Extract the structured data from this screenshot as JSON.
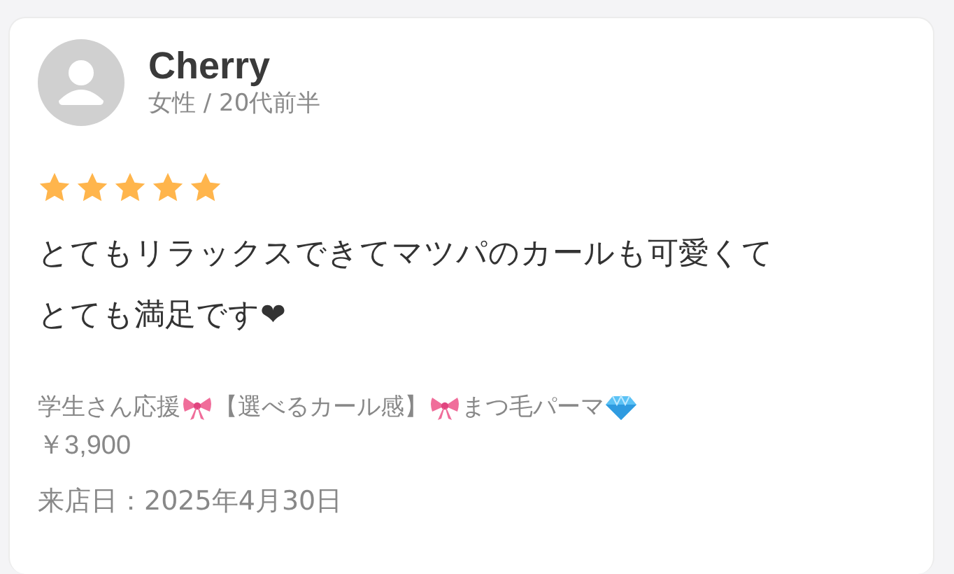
{
  "reviewer": {
    "name": "Cherry",
    "profile": "女性 / 20代前半"
  },
  "rating": {
    "stars": 5
  },
  "review": {
    "text": "とてもリラックスできてマツパのカールも可愛くてとても満足です❤"
  },
  "menu": {
    "parts": [
      {
        "kind": "text",
        "text": "学生さん応援"
      },
      {
        "kind": "bow"
      },
      {
        "kind": "text",
        "text": "【選べるカール感】"
      },
      {
        "kind": "bow"
      },
      {
        "kind": "text",
        "text": "まつ毛パーマ"
      },
      {
        "kind": "diamond"
      }
    ],
    "price": "￥3,900"
  },
  "visit": {
    "text": "来店日：2025年4月30日"
  }
}
